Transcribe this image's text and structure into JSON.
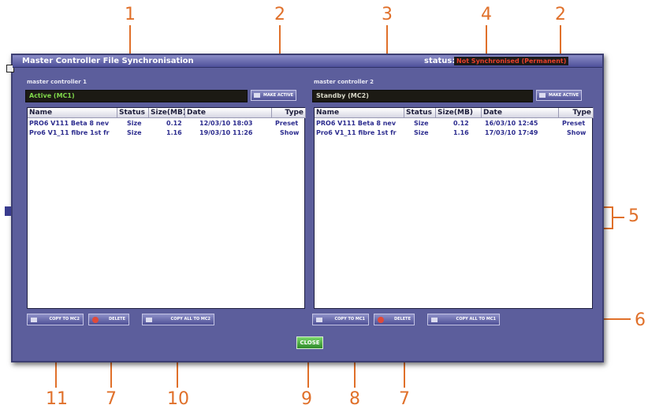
{
  "callouts": [
    "1",
    "2",
    "3",
    "4",
    "2",
    "5",
    "6",
    "11",
    "7",
    "10",
    "9",
    "8",
    "7"
  ],
  "window": {
    "title": "Master Controller File Synchronisation",
    "status_label": "status:",
    "status_value": "Not Synchronised (Permanent)"
  },
  "left": {
    "label": "master controller 1",
    "state": "Active (MC1)",
    "make_active": "MAKE ACTIVE"
  },
  "right": {
    "label": "master controller 2",
    "state": "Standby (MC2)",
    "make_active": "MAKE ACTIVE"
  },
  "columns": [
    "Name",
    "Status",
    "Size(MB)",
    "Date",
    "Type"
  ],
  "left_rows": [
    {
      "name": "PRO6 V111 Beta 8 nev",
      "status": "Size",
      "size": "0.12",
      "date": "12/03/10 18:03",
      "type": "Preset"
    },
    {
      "name": "Pro6 V1_11 fibre 1st fr",
      "status": "Size",
      "size": "1.16",
      "date": "19/03/10 11:26",
      "type": "Show"
    }
  ],
  "right_rows": [
    {
      "name": "PRO6 V111 Beta 8 nev",
      "status": "Size",
      "size": "0.12",
      "date": "16/03/10 12:45",
      "type": "Preset"
    },
    {
      "name": "Pro6 V1_11 fibre 1st fr",
      "status": "Size",
      "size": "1.16",
      "date": "17/03/10 17:49",
      "type": "Show"
    }
  ],
  "buttons": {
    "copy_to_mc2": "COPY TO MC2",
    "delete": "DELETE",
    "copy_all_to_mc2": "COPY ALL TO MC2",
    "copy_to_mc1": "COPY TO MC1",
    "copy_all_to_mc1": "COPY ALL TO MC1",
    "close": "CLOSE"
  },
  "colors": {
    "accent": "#e0702a",
    "active_text": "#7fd84a",
    "standby_text": "#d8d8c8",
    "status_text": "#e8402a"
  }
}
